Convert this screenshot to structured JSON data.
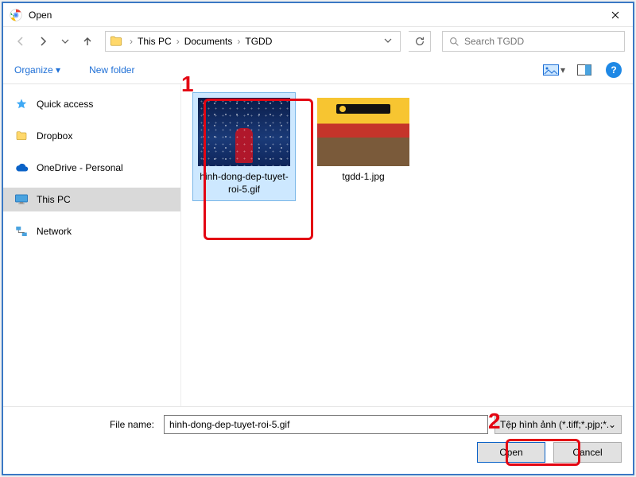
{
  "title": "Open",
  "nav": {
    "back_enabled": false,
    "forward_enabled": true
  },
  "breadcrumb": {
    "parts": [
      "This PC",
      "Documents",
      "TGDD"
    ]
  },
  "search": {
    "placeholder": "Search TGDD"
  },
  "toolbar": {
    "organize": "Organize",
    "new_folder": "New folder"
  },
  "sidebar": {
    "items": [
      {
        "label": "Quick access",
        "icon": "star"
      },
      {
        "label": "Dropbox",
        "icon": "dropbox"
      },
      {
        "label": "OneDrive - Personal",
        "icon": "onedrive"
      },
      {
        "label": "This PC",
        "icon": "monitor",
        "selected": true
      },
      {
        "label": "Network",
        "icon": "network"
      }
    ]
  },
  "files": [
    {
      "name": "hinh-dong-dep-tuyet-roi-5.gif",
      "thumb": "snow",
      "selected": true
    },
    {
      "name": "tgdd-1.jpg",
      "thumb": "store",
      "selected": false
    }
  ],
  "filename": {
    "label": "File name:",
    "value": "hinh-dong-dep-tuyet-roi-5.gif"
  },
  "filetype": {
    "label": "Tệp hình ảnh (*.tiff;*.pjp;*.jfif;*.g"
  },
  "buttons": {
    "open": "Open",
    "cancel": "Cancel"
  },
  "annotations": {
    "n1": "1",
    "n2": "2"
  }
}
